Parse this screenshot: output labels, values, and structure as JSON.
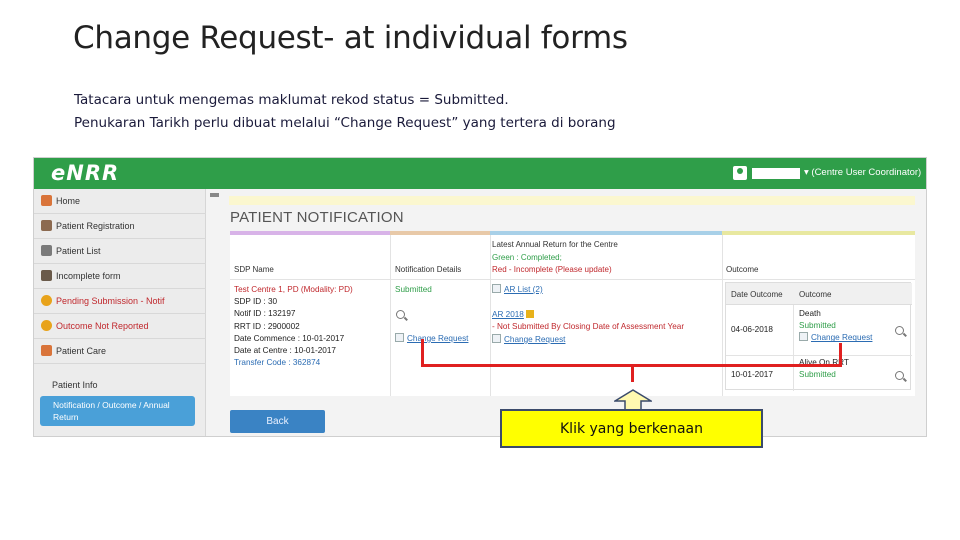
{
  "slide": {
    "title": "Change Request- at individual forms",
    "line1": "Tatacara untuk mengemas maklumat rekod status = Submitted.",
    "line2": "Penukaran Tarikh perlu dibuat melalui “Change Request”  yang tertera di borang"
  },
  "app": {
    "logo": "eNRR",
    "user_role": "▾ (Centre User Coordinator)",
    "accent": "#2f9e49"
  },
  "sidebar": {
    "items": [
      {
        "label": "Home",
        "icon": "home-icon"
      },
      {
        "label": "Patient Registration",
        "icon": "registration-icon"
      },
      {
        "label": "Patient List",
        "icon": "list-icon"
      },
      {
        "label": "Incomplete form",
        "icon": "form-icon"
      },
      {
        "label": "Pending Submission - Notif",
        "icon": "star-icon"
      },
      {
        "label": "Outcome Not Reported",
        "icon": "star-icon"
      },
      {
        "label": "Patient Care",
        "icon": "care-icon"
      }
    ],
    "section_label": "Patient Info",
    "active_line1": "Notification / Outcome / Annual",
    "active_line2": "Return"
  },
  "page": {
    "title": "PATIENT NOTIFICATION",
    "back_label": "Back"
  },
  "table": {
    "headers": {
      "sdp": "SDP Name",
      "notif": "Notification Details",
      "annual_title": "Latest Annual Return for the Centre",
      "annual_green": "Green : Completed;",
      "annual_red": "Red - Incomplete (Please update)",
      "outcome": "Outcome"
    },
    "sdp": {
      "name": "Test Centre 1, PD (Modality: PD)",
      "sdp_id": "SDP ID : 30",
      "notif_id": "Notif ID : 132197",
      "rrt_id": "RRT ID : 2900002",
      "date_commence": "Date Commence : 10-01-2017",
      "date_centre": "Date at Centre : 10-01-2017",
      "transfer": "Transfer Code : 362874"
    },
    "notif": {
      "status": "Submitted",
      "change_request": "Change Request"
    },
    "annual": {
      "ar_list": "AR List (2)",
      "ar_year": "AR 2018",
      "not_submitted": "- Not Submitted By Closing Date of Assessment Year",
      "change_request": "Change Request"
    },
    "outcome": {
      "col_date": "Date Outcome",
      "col_outcome": "Outcome",
      "rows": [
        {
          "date": "04-06-2018",
          "line1": "Death",
          "line2": "Submitted",
          "link": "Change Request"
        },
        {
          "date": "10-01-2017",
          "line1": "Alive On RRT",
          "line2": "Submitted",
          "link": ""
        }
      ]
    }
  },
  "callout": {
    "text": "Klik yang berkenaan",
    "fill": "#ffff00",
    "line_color": "#e02020"
  }
}
